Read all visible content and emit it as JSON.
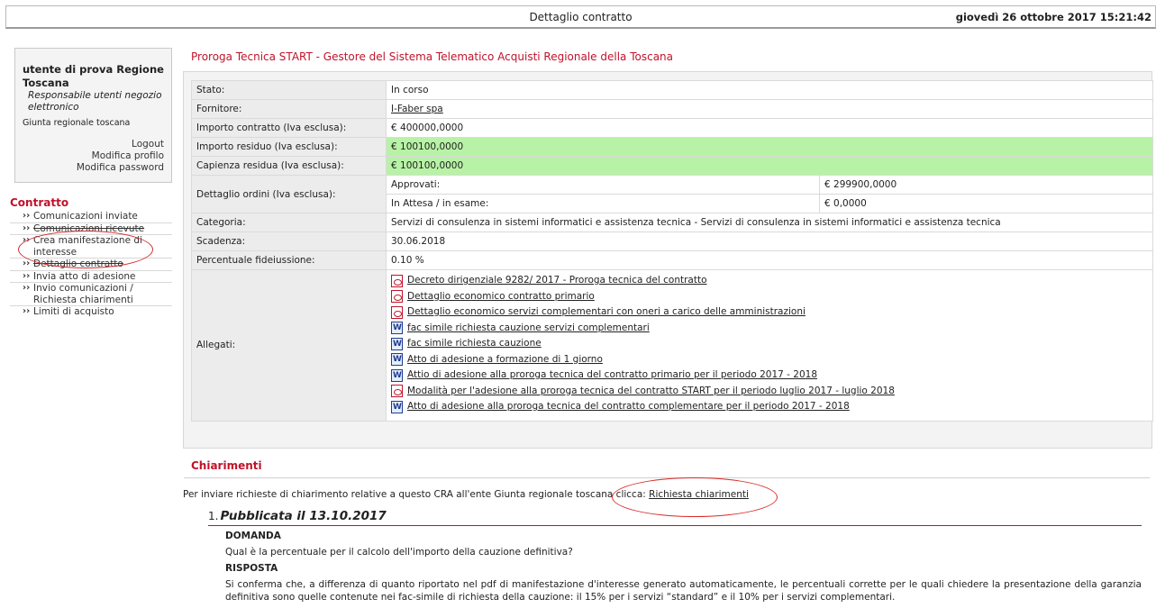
{
  "header": {
    "title": "Dettaglio contratto",
    "datetime": "giovedì 26 ottobre 2017 15:21:42"
  },
  "user": {
    "name": "utente di prova Regione Toscana",
    "role": "Responsabile utenti negozio elettronico",
    "org": "Giunta regionale toscana",
    "links": [
      "Logout",
      "Modifica profilo",
      "Modifica password"
    ]
  },
  "menu": {
    "title": "Contratto",
    "items": [
      {
        "label": "Comunicazioni inviate"
      },
      {
        "label": "Comunicazioni ricevute"
      },
      {
        "label": "Crea manifestazione di interesse"
      },
      {
        "label": "Dettaglio contratto"
      },
      {
        "label": "Invia atto di adesione"
      },
      {
        "label": "Invio comunicazioni / Richiesta chiarimenti"
      },
      {
        "label": "Limiti di acquisto"
      }
    ]
  },
  "contract": {
    "title": "Proroga Tecnica START - Gestore del Sistema Telematico Acquisti Regionale della Toscana",
    "rows": [
      {
        "label": "Stato:",
        "value": "In corso"
      },
      {
        "label": "Fornitore:",
        "value": "I-Faber spa"
      },
      {
        "label": "Importo contratto (Iva esclusa):",
        "value": "€ 400000,0000"
      },
      {
        "label": "Importo residuo (Iva esclusa):",
        "value": "€ 100100,0000"
      },
      {
        "label": "Capienza residua (Iva esclusa):",
        "value": "€ 100100,0000"
      }
    ],
    "ordini": {
      "label": "Dettaglio ordini (Iva esclusa):",
      "approvati_label": "Approvati:",
      "approvati_value": "€ 299900,0000",
      "attesa_label": "In Attesa / in esame:",
      "attesa_value": "€ 0,0000"
    },
    "rows2": [
      {
        "label": "Categoria:",
        "value": "Servizi di consulenza in sistemi informatici e assistenza tecnica - Servizi di consulenza in sistemi informatici e assistenza tecnica"
      },
      {
        "label": "Scadenza:",
        "value": "30.06.2018"
      },
      {
        "label": "Percentuale fideiussione:",
        "value": "0.10 %"
      }
    ],
    "allegati_label": "Allegati:",
    "allegati": [
      {
        "type": "pdf-icon",
        "label": "Decreto dirigenziale 9282/ 2017 - Proroga tecnica del contratto"
      },
      {
        "type": "pdf-icon",
        "label": "Dettaglio economico contratto primario"
      },
      {
        "type": "pdf-icon",
        "label": "Dettaglio economico servizi complementari con oneri a carico delle amministrazioni"
      },
      {
        "type": "word-icon",
        "label": "fac simile richiesta cauzione servizi complementari"
      },
      {
        "type": "word-icon",
        "label": "fac simile richiesta cauzione"
      },
      {
        "type": "word-icon",
        "label": "Atto di adesione a formazione di 1 giorno"
      },
      {
        "type": "word-icon",
        "label": "Attio di adesione alla proroga tecnica del contratto primario per il periodo 2017 - 2018"
      },
      {
        "type": "pdf-icon",
        "label": " Modalità per l'adesione alla proroga tecnica del contratto START per il periodo luglio 2017 - luglio 2018"
      },
      {
        "type": "word-icon",
        "label": "Atto di adesione alla proroga tecnica del contratto complementare per il periodo 2017 - 2018"
      }
    ]
  },
  "chiarimenti": {
    "title": "Chiarimenti",
    "intro": "Per inviare richieste di chiarimento relative a questo CRA all'ente Giunta regionale toscana clicca:",
    "link": "Richiesta chiarimenti",
    "items": [
      {
        "number": "1.",
        "published": "Pubblicata il 13.10.2017",
        "domanda_label": "DOMANDA",
        "domanda": "Qual è la percentuale per il calcolo dell'importo della cauzione definitiva?",
        "risposta_label": "RISPOSTA",
        "risposta": "Si conferma che, a differenza di quanto riportato nel pdf di manifestazione d'interesse generato automaticamente, le percentuali corrette per le quali chiedere la presentazione della garanzia definitiva sono quelle contenute nei fac-simile di richiesta della cauzione: il 15% per i servizi “standard” e il 10% per i servizi complementari."
      }
    ]
  },
  "colors": {
    "accent": "#c0132a",
    "highlight": "#b8f2a6"
  }
}
